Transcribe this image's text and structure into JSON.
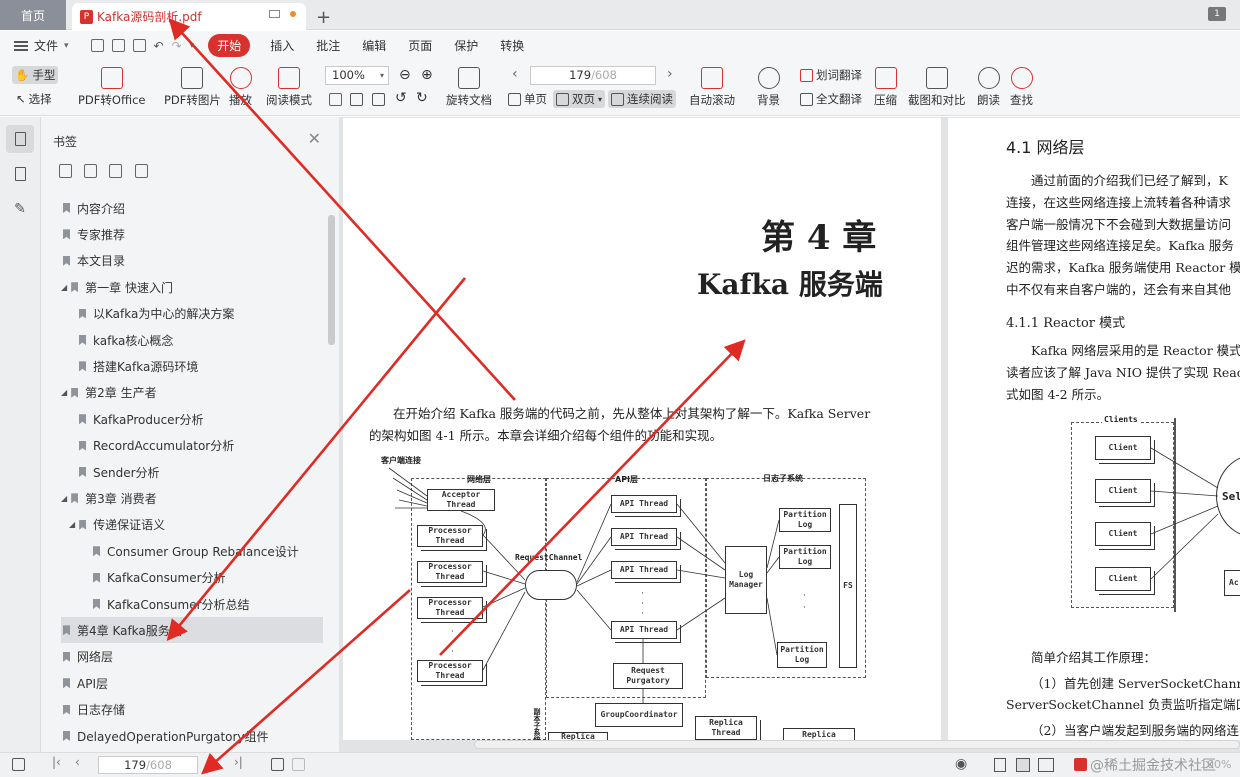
{
  "tabs": {
    "home": "首页",
    "doc": "Kafka源码剖析.pdf",
    "new": "+",
    "window_count": "1"
  },
  "menu": {
    "file": "文件",
    "items": [
      "开始",
      "插入",
      "批注",
      "编辑",
      "页面",
      "保护",
      "转换"
    ]
  },
  "toolbar": {
    "hand": "手型",
    "select": "选择",
    "pdf_to_office": "PDF转Office",
    "pdf_to_image": "PDF转图片",
    "play": "播放",
    "read_mode": "阅读模式",
    "zoom": "100%",
    "rotate": "旋转文档",
    "single_page": "单页",
    "double_page": "双页",
    "continuous": "连续阅读",
    "page_current": "179",
    "page_total": "/608",
    "auto_scroll": "自动滚动",
    "background": "背景",
    "word_translate": "划词翻译",
    "full_translate": "全文翻译",
    "compress": "压缩",
    "screenshot": "截图和对比",
    "read_aloud": "朗读",
    "search": "查找"
  },
  "sidebar": {
    "title": "书签",
    "items": [
      {
        "label": "内容介绍",
        "level": 0
      },
      {
        "label": "专家推荐",
        "level": 0
      },
      {
        "label": "本文目录",
        "level": 0
      },
      {
        "label": "第一章 快速入门",
        "level": 0,
        "expanded": true
      },
      {
        "label": "以Kafka为中心的解决方案",
        "level": 1
      },
      {
        "label": "kafka核心概念",
        "level": 1
      },
      {
        "label": "搭建Kafka源码环境",
        "level": 1
      },
      {
        "label": "第2章 生产者",
        "level": 0,
        "expanded": true
      },
      {
        "label": "KafkaProducer分析",
        "level": 1
      },
      {
        "label": "RecordAccumulator分析",
        "level": 1
      },
      {
        "label": "Sender分析",
        "level": 1
      },
      {
        "label": "第3章 消费者",
        "level": 0,
        "expanded": true
      },
      {
        "label": "传递保证语义",
        "level": 1,
        "expanded": true
      },
      {
        "label": "Consumer Group Rebalance设计",
        "level": 2
      },
      {
        "label": "KafkaConsumer分析",
        "level": 2
      },
      {
        "label": "KafkaConsumer分析总结",
        "level": 2
      },
      {
        "label": "第4章 Kafka服务端",
        "level": 0,
        "selected": true
      },
      {
        "label": "网络层",
        "level": 0
      },
      {
        "label": "API层",
        "level": 0
      },
      {
        "label": "日志存储",
        "level": 0
      },
      {
        "label": "DelayedOperationPurgatory组件",
        "level": 0
      }
    ]
  },
  "page_left": {
    "chapter": "第 4 章",
    "title": "Kafka 服务端",
    "para1": "在开始介绍 Kafka 服务端的代码之前，先从整体上对其架构了解一下。Kafka Server",
    "para2": "的架构如图 4-1 所示。本章会详细介绍每个组件的功能和实现。",
    "fig": {
      "client_conn": "客户端连接",
      "net_layer": "网络层",
      "api_layer": "API层",
      "log_subsys": "日志子系统",
      "acceptor": "Acceptor\nThread",
      "processor": "Processor\nThread",
      "request_channel": "RequestChannel",
      "api_thread": "API Thread",
      "log_manager": "Log\nManager",
      "partition_log": "Partition\nLog",
      "fs": "FS",
      "request_purgatory": "Request\nPurgatory",
      "group_coordinator": "GroupCoordinator",
      "replica_thread": "Replica\nThread",
      "replica": "Replica",
      "vertical_label": "副本子系统"
    }
  },
  "page_right": {
    "h1": "4.1   网络层",
    "lines": [
      "通过前面的介绍我们已经了解到，K",
      "连接，在这些网络连接上流转着各种请求",
      "客户端一般情况下不会碰到大数据量访问",
      "组件管理这些网络连接足矣。Kafka 服务",
      "迟的需求，Kafka 服务端使用 Reactor 模式",
      "中不仅有来自客户端的，还会有来自其他"
    ],
    "h2": "4.1.1   Reactor 模式",
    "lines2": [
      "Kafka 网络层采用的是 Reactor 模式",
      "读者应该了解 Java NIO 提供了实现 React",
      "式如图 4-2 所示。"
    ],
    "fig": {
      "clients": "Clients",
      "client": "Client",
      "selector": "Sel",
      "ac": "Ac"
    },
    "lines3": [
      "简单介绍其工作原理：",
      "（1）首先创建 ServerSocketChanne",
      "ServerSocketChannel 负责监听指定端口上",
      "（2）当客户端发起到服务端的网络连"
    ]
  },
  "statusbar": {
    "page_current": "179",
    "page_total": "/608",
    "watermark": "@稀土掘金技术社区",
    "zoom": "100%"
  },
  "colors": {
    "accent": "#d8322e",
    "arrow": "#e02a24"
  }
}
